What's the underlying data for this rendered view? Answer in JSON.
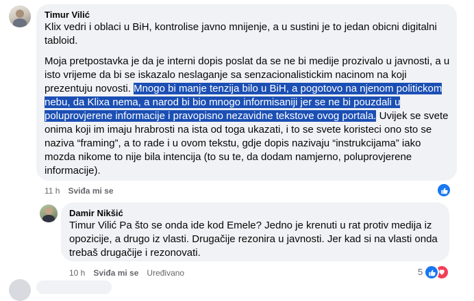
{
  "comments": [
    {
      "author": "Timur Vilić",
      "paragraph1": "Klix vedri i oblaci u BiH, kontrolise javno mnijenje, a u sustini je to jedan obicni digitalni tabloid.",
      "paragraph2_start": "Moja pretpostavka je da je interni dopis poslat da se ne bi medije prozivalo u javnosti, a u isto vrijeme da bi se iskazalo neslaganje sa senzacionalistickim nacinom na koji prezentuju novosti. ",
      "paragraph2_highlight": "Mnogo bi manje tenzija bilo u BiH, a pogotovo na njenom politickom nebu, da Klixa nema, a narod bi bio mnogo informisaniji jer se ne bi pouzdali u poluprovjerene informacije i pravopisno nezavidne tekstove ovog portala.",
      "paragraph2_end": " Uvijek se svete onima koji im imaju hrabrosti na ista od toga ukazati, i to se svete koristeci ono sto se naziva “framing”, a to rade i u ovom tekstu, gdje dopis nazivaju “instrukcijama” iako mozda nikome to nije bila intencija (to su te, da dodam namjerno, poluprovjerene informacije).",
      "time": "11 h",
      "like_action": "Sviđa mi se",
      "reactions": [
        "like-icon"
      ]
    },
    {
      "author": "Damir Nikšić",
      "text": "Timur Vilić Pa što se onda ide kod Emele? Jedno je krenuti u rat protiv medija iz opozicije, a drugo iz vlasti. Drugačije rezonira u javnosti. Jer kad si na vlasti onda trebaš drugačije i rezonovati.",
      "time": "10 h",
      "like_action": "Sviđa mi se",
      "edited": "Uređivano",
      "reaction_count": "5",
      "reactions": [
        "like-icon",
        "love-icon"
      ]
    }
  ],
  "colors": {
    "bubble": "#f0f2f5",
    "highlight": "#1b4fb4",
    "like": "#1877f2",
    "love": "#f33e58",
    "meta": "#65676b"
  }
}
